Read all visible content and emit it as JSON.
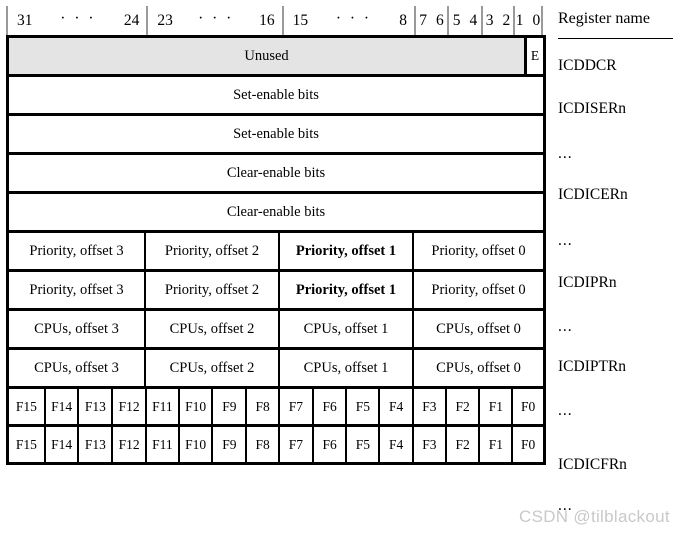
{
  "header": {
    "bit_groups": [
      {
        "left": "31",
        "dots": "· · ·",
        "right": "24"
      },
      {
        "left": "23",
        "dots": "· · ·",
        "right": "16"
      },
      {
        "left": "15",
        "dots": "· · ·",
        "right": "8"
      }
    ],
    "bit_pairs": [
      {
        "a": "7",
        "b": "6"
      },
      {
        "a": "5",
        "b": "4"
      },
      {
        "a": "3",
        "b": "2"
      },
      {
        "a": "1",
        "b": "0"
      }
    ],
    "register_name_title": "Register name"
  },
  "rows": [
    {
      "kind": "unused",
      "cells": [
        {
          "text": "Unused",
          "shaded": true,
          "bold": false
        },
        {
          "text": "E",
          "shaded": false,
          "bold": false
        }
      ],
      "register_name": "ICDDCR"
    },
    {
      "kind": "full",
      "cells": [
        {
          "text": "Set-enable bits",
          "bold": false
        }
      ],
      "register_name": "ICDISERn"
    },
    {
      "kind": "full",
      "cells": [
        {
          "text": "Set-enable bits",
          "bold": false
        }
      ],
      "register_name": "..."
    },
    {
      "kind": "full",
      "cells": [
        {
          "text": "Clear-enable bits",
          "bold": false
        }
      ],
      "register_name": "ICDICERn"
    },
    {
      "kind": "full",
      "cells": [
        {
          "text": "Clear-enable bits",
          "bold": false
        }
      ],
      "register_name": "..."
    },
    {
      "kind": "quad",
      "cells": [
        {
          "text": "Priority, offset 3",
          "bold": false
        },
        {
          "text": "Priority, offset 2",
          "bold": false
        },
        {
          "text": "Priority, offset 1",
          "bold": true
        },
        {
          "text": "Priority, offset 0",
          "bold": false
        }
      ],
      "register_name": "ICDIPRn"
    },
    {
      "kind": "quad",
      "cells": [
        {
          "text": "Priority, offset 3",
          "bold": false
        },
        {
          "text": "Priority, offset 2",
          "bold": false
        },
        {
          "text": "Priority, offset 1",
          "bold": true
        },
        {
          "text": "Priority, offset 0",
          "bold": false
        }
      ],
      "register_name": "..."
    },
    {
      "kind": "quad",
      "cells": [
        {
          "text": "CPUs, offset 3",
          "bold": false
        },
        {
          "text": "CPUs, offset 2",
          "bold": false
        },
        {
          "text": "CPUs, offset 1",
          "bold": false
        },
        {
          "text": "CPUs, offset 0",
          "bold": false
        }
      ],
      "register_name": "ICDIPTRn"
    },
    {
      "kind": "quad",
      "cells": [
        {
          "text": "CPUs, offset 3",
          "bold": false
        },
        {
          "text": "CPUs, offset 2",
          "bold": false
        },
        {
          "text": "CPUs, offset 1",
          "bold": false
        },
        {
          "text": "CPUs, offset 0",
          "bold": false
        }
      ],
      "register_name": "..."
    },
    {
      "kind": "fields",
      "cells": [
        {
          "text": "F15"
        },
        {
          "text": "F14"
        },
        {
          "text": "F13"
        },
        {
          "text": "F12"
        },
        {
          "text": "F11"
        },
        {
          "text": "F10"
        },
        {
          "text": "F9"
        },
        {
          "text": "F8"
        },
        {
          "text": "F7"
        },
        {
          "text": "F6"
        },
        {
          "text": "F5"
        },
        {
          "text": "F4"
        },
        {
          "text": "F3"
        },
        {
          "text": "F2"
        },
        {
          "text": "F1"
        },
        {
          "text": "F0"
        }
      ],
      "register_name": "ICDICFRn"
    },
    {
      "kind": "fields",
      "cells": [
        {
          "text": "F15"
        },
        {
          "text": "F14"
        },
        {
          "text": "F13"
        },
        {
          "text": "F12"
        },
        {
          "text": "F11"
        },
        {
          "text": "F10"
        },
        {
          "text": "F9"
        },
        {
          "text": "F8"
        },
        {
          "text": "F7"
        },
        {
          "text": "F6"
        },
        {
          "text": "F5"
        },
        {
          "text": "F4"
        },
        {
          "text": "F3"
        },
        {
          "text": "F2"
        },
        {
          "text": "F1"
        },
        {
          "text": "F0"
        }
      ],
      "register_name": "..."
    }
  ],
  "watermark": "CSDN @tilblackout",
  "colors": {
    "border": "#000000",
    "shaded_cell": "#e4e4e4",
    "header_tick": "#9a9a9a",
    "watermark": "#c9c9c9"
  }
}
